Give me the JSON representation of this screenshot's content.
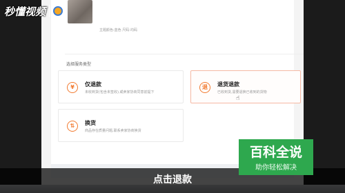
{
  "overlay": {
    "logo_text": "秒懂视频",
    "caption": "点击退款",
    "badge_title": "百科全说",
    "badge_subtitle": "助你轻松解决"
  },
  "product": {
    "subtitle": "主题颜色:蓝色  尺码:均码"
  },
  "service": {
    "section_label": "选择服务类型",
    "options": [
      {
        "label": "仅退款",
        "description": "未收到货(包含未签收),或卖家协商同意前提下",
        "icon": "refund-icon"
      },
      {
        "label": "退货退款",
        "description": "已收到货,需要退换已收到的货物",
        "icon": "return-refund-icon"
      },
      {
        "label": "换货",
        "description": "商品存在质量问题,联系卖家协商换货",
        "icon": "exchange-icon"
      }
    ]
  },
  "colors": {
    "accent": "#f27a2f",
    "badge": "#2ea84e"
  }
}
